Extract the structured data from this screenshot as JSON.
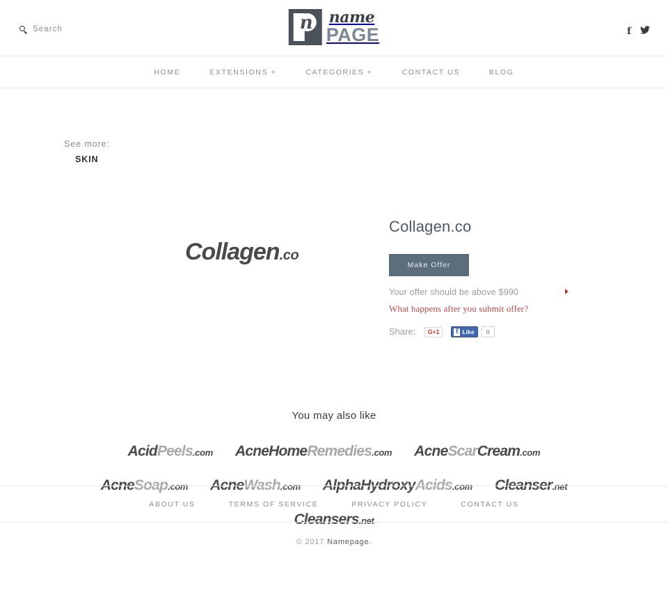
{
  "header": {
    "search_label": "Search",
    "search_icon": "search-icon",
    "logo": {
      "mark_letter": "n",
      "name": "name",
      "page": "PAGE"
    },
    "social": [
      {
        "name": "facebook-icon",
        "glyph": "f"
      },
      {
        "name": "twitter-icon",
        "glyph": "✐"
      }
    ]
  },
  "nav": {
    "items": [
      {
        "label": "HOME"
      },
      {
        "label": "EXTENSIONS +"
      },
      {
        "label": "CATEGORIES +"
      },
      {
        "label": "CONTACT US"
      },
      {
        "label": "BLOG"
      }
    ]
  },
  "see_more": {
    "label": "See more:",
    "category": "SKIN"
  },
  "domain": {
    "logo_name": "Collagen",
    "logo_tld": ".co",
    "title": "Collagen.co",
    "make_offer_label": "Make Offer",
    "offer_note": "Your offer should be above $990",
    "offer_minimum": "$990",
    "offer_question": "What happens after you submit offer?",
    "share_label": "Share:",
    "gplus_label": "G+1",
    "fb_like_label": "Like",
    "fb_like_icon": "f",
    "fb_count": "0"
  },
  "also_like": {
    "title": "You may also like",
    "items": [
      {
        "dark": "Acid",
        "light": "Peels",
        "tld": ".com"
      },
      {
        "dark": "AcneHome",
        "light": "Remedies",
        "tld": ".com"
      },
      {
        "dark": "Acne",
        "light": "Scar",
        "dark2": "Cream",
        "tld": ".com"
      },
      {
        "dark": "Acne",
        "light": "Soap",
        "tld": ".com"
      },
      {
        "dark": "Acne",
        "light": "Wash",
        "tld": ".com"
      },
      {
        "dark": "AlphaHydroxy",
        "light": "Acids",
        "tld": ".com"
      },
      {
        "dark": "Cleanser",
        "light": "",
        "tld": ".net"
      },
      {
        "dark": "Cleansers",
        "light": "",
        "tld": ".net"
      }
    ]
  },
  "footer": {
    "links": [
      {
        "label": "ABOUT US"
      },
      {
        "label": "TERMS OF SERVICE"
      },
      {
        "label": "PRIVACY POLICY"
      },
      {
        "label": "CONTACT US"
      }
    ],
    "copyright": "© 2017",
    "brand": "Namepage."
  },
  "colors": {
    "accent_button": "#5c6d7c",
    "link_red": "#b94a48",
    "muted_text": "#9b9b9b",
    "logo_page": "#7b8794"
  }
}
